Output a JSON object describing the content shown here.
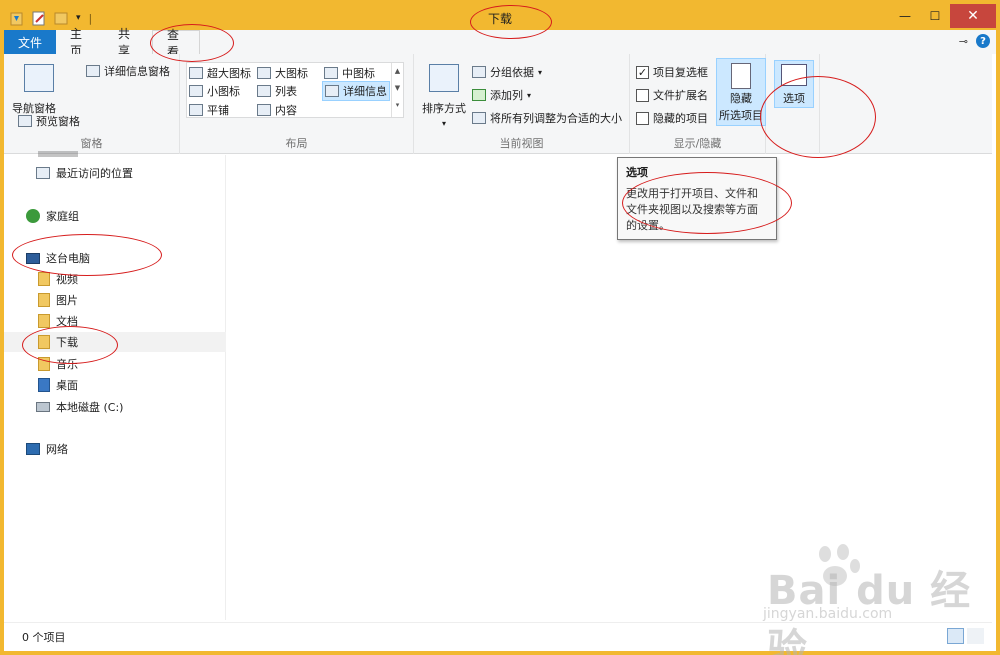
{
  "window": {
    "title": "下载"
  },
  "tabs": [
    {
      "label": "文件"
    },
    {
      "label": "主页"
    },
    {
      "label": "共享"
    },
    {
      "label": "查看"
    }
  ],
  "ribbon": {
    "panes": {
      "label": "窗格",
      "nav_pane": "导航窗格",
      "preview_pane": "预览窗格",
      "details_pane": "详细信息窗格"
    },
    "layout": {
      "label": "布局",
      "items": [
        "超大图标",
        "大图标",
        "中图标",
        "小图标",
        "列表",
        "详细信息",
        "平铺",
        "内容"
      ],
      "selected": "详细信息"
    },
    "current_view": {
      "label": "当前视图",
      "sort_by": "排序方式",
      "group_by": "分组依据",
      "add_columns": "添加列",
      "size_all_columns": "将所有列调整为合适的大小"
    },
    "show_hide": {
      "label": "显示/隐藏",
      "item_checkboxes": "项目复选框",
      "item_checkboxes_checked": true,
      "file_extensions": "文件扩展名",
      "hidden_items": "隐藏的项目",
      "hide_selected_line1": "隐藏",
      "hide_selected_line2": "所选项目"
    },
    "options": {
      "label": "选项"
    }
  },
  "tooltip": {
    "title": "选项",
    "body": "更改用于打开项目、文件和文件夹视图以及搜索等方面的设置。"
  },
  "nav": {
    "recent": "最近访问的位置",
    "homegroup": "家庭组",
    "this_pc": "这台电脑",
    "videos": "视频",
    "pictures": "图片",
    "documents": "文档",
    "downloads": "下载",
    "music": "音乐",
    "desktop": "桌面",
    "local_disk": "本地磁盘 (C:)",
    "network": "网络"
  },
  "status": {
    "items_count": "0 个项目"
  },
  "watermark": {
    "brand": "Bai du 经验",
    "url": "jingyan.baidu.com"
  },
  "colors": {
    "titlebar": "#f2b830",
    "file_tab": "#1979ca",
    "close": "#c7463d",
    "annotation": "#d61c1c"
  }
}
